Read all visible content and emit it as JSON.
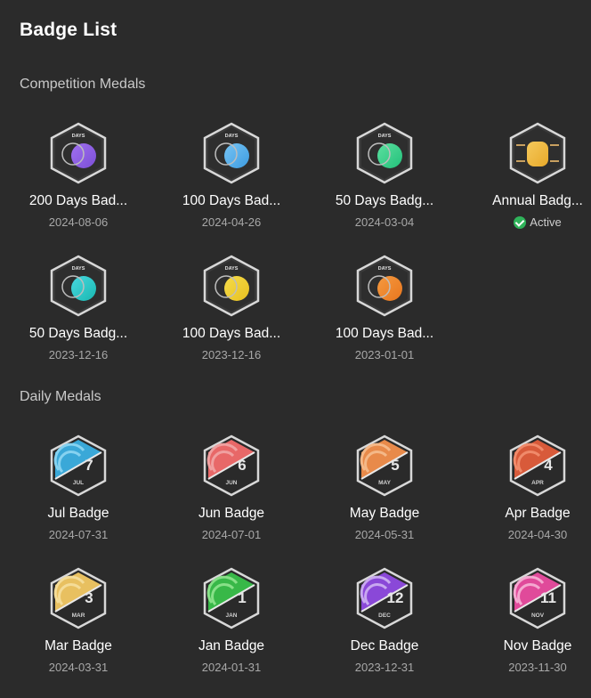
{
  "page": {
    "title": "Badge List"
  },
  "sections": {
    "competition": {
      "title": "Competition Medals"
    },
    "daily": {
      "title": "Daily Medals"
    }
  },
  "competition_badges": [
    {
      "name": "200 Days Bad...",
      "date": "2024-08-06",
      "icon_text": "DAYS",
      "accent": "#7b4fd6",
      "accent2": "#a070f0"
    },
    {
      "name": "100 Days Bad...",
      "date": "2024-04-26",
      "icon_text": "DAYS",
      "accent": "#3d9be0",
      "accent2": "#76c4f4"
    },
    {
      "name": "50 Days Badg...",
      "date": "2024-03-04",
      "icon_text": "DAYS",
      "accent": "#22c07a",
      "accent2": "#5de0a0"
    },
    {
      "name": "Annual Badg...",
      "status": "Active",
      "icon_text": "2023",
      "accent": "#e8a92a",
      "accent2": "#f5c95c"
    },
    {
      "name": "50 Days Badg...",
      "date": "2023-12-16",
      "icon_text": "DAYS",
      "accent": "#19b8b0",
      "accent2": "#48d8e0"
    },
    {
      "name": "100 Days Bad...",
      "date": "2023-12-16",
      "icon_text": "DAYS",
      "accent": "#e8c020",
      "accent2": "#f5dc4a"
    },
    {
      "name": "100 Days Bad...",
      "date": "2023-01-01",
      "icon_text": "DAYS",
      "accent": "#e8761e",
      "accent2": "#f59a40"
    }
  ],
  "daily_badges": [
    {
      "name": "Jul Badge",
      "date": "2024-07-31",
      "num": "7",
      "month": "JUL",
      "accent": "#3aa8d8",
      "accent2": "#86d2f0"
    },
    {
      "name": "Jun Badge",
      "date": "2024-07-01",
      "num": "6",
      "month": "JUN",
      "accent": "#e86868",
      "accent2": "#f0a0a0"
    },
    {
      "name": "May Badge",
      "date": "2024-05-31",
      "num": "5",
      "month": "MAY",
      "accent": "#e88a4a",
      "accent2": "#f4b888"
    },
    {
      "name": "Apr Badge",
      "date": "2024-04-30",
      "num": "4",
      "month": "APR",
      "accent": "#d85a3a",
      "accent2": "#f08a6a"
    },
    {
      "name": "Mar Badge",
      "date": "2024-03-31",
      "num": "3",
      "month": "MAR",
      "accent": "#e8c060",
      "accent2": "#f4dc98"
    },
    {
      "name": "Jan Badge",
      "date": "2024-01-31",
      "num": "1",
      "month": "JAN",
      "accent": "#38b848",
      "accent2": "#88e088"
    },
    {
      "name": "Dec Badge",
      "date": "2023-12-31",
      "num": "12",
      "month": "DEC",
      "accent": "#8a48d8",
      "accent2": "#c8a8f0"
    },
    {
      "name": "Nov Badge",
      "date": "2023-11-30",
      "num": "11",
      "month": "NOV",
      "accent": "#e04a9a",
      "accent2": "#f4a8d0"
    }
  ]
}
